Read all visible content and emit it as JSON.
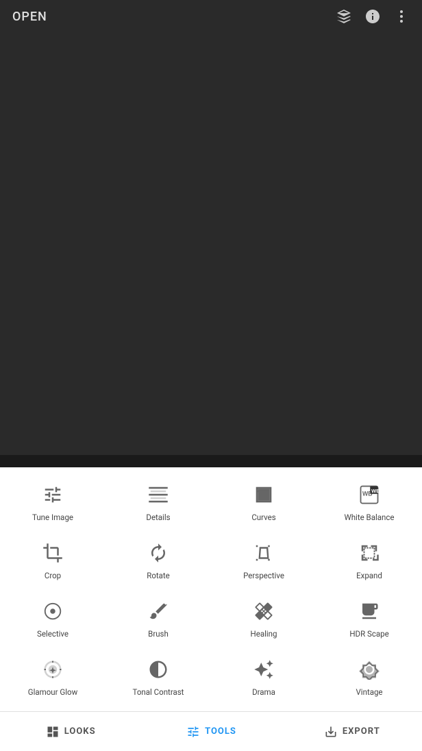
{
  "header": {
    "open_label": "OPEN"
  },
  "tools": [
    {
      "id": "tune-image",
      "label": "Tune Image",
      "icon": "tune"
    },
    {
      "id": "details",
      "label": "Details",
      "icon": "details"
    },
    {
      "id": "curves",
      "label": "Curves",
      "icon": "curves"
    },
    {
      "id": "white-balance",
      "label": "White Balance",
      "icon": "wb"
    },
    {
      "id": "crop",
      "label": "Crop",
      "icon": "crop"
    },
    {
      "id": "rotate",
      "label": "Rotate",
      "icon": "rotate"
    },
    {
      "id": "perspective",
      "label": "Perspective",
      "icon": "perspective"
    },
    {
      "id": "expand",
      "label": "Expand",
      "icon": "expand"
    },
    {
      "id": "selective",
      "label": "Selective",
      "icon": "selective"
    },
    {
      "id": "brush",
      "label": "Brush",
      "icon": "brush"
    },
    {
      "id": "healing",
      "label": "Healing",
      "icon": "healing"
    },
    {
      "id": "hdr-scape",
      "label": "HDR Scape",
      "icon": "hdr"
    },
    {
      "id": "glamour-glow",
      "label": "Glamour Glow",
      "icon": "glamour"
    },
    {
      "id": "tonal-contrast",
      "label": "Tonal Contrast",
      "icon": "tonal"
    },
    {
      "id": "drama",
      "label": "Drama",
      "icon": "drama"
    },
    {
      "id": "vintage",
      "label": "Vintage",
      "icon": "vintage"
    }
  ],
  "bottom_nav": [
    {
      "id": "looks",
      "label": "LOOKS",
      "active": false
    },
    {
      "id": "tools",
      "label": "TOOLS",
      "active": true
    },
    {
      "id": "export",
      "label": "EXPORT",
      "active": false
    }
  ]
}
